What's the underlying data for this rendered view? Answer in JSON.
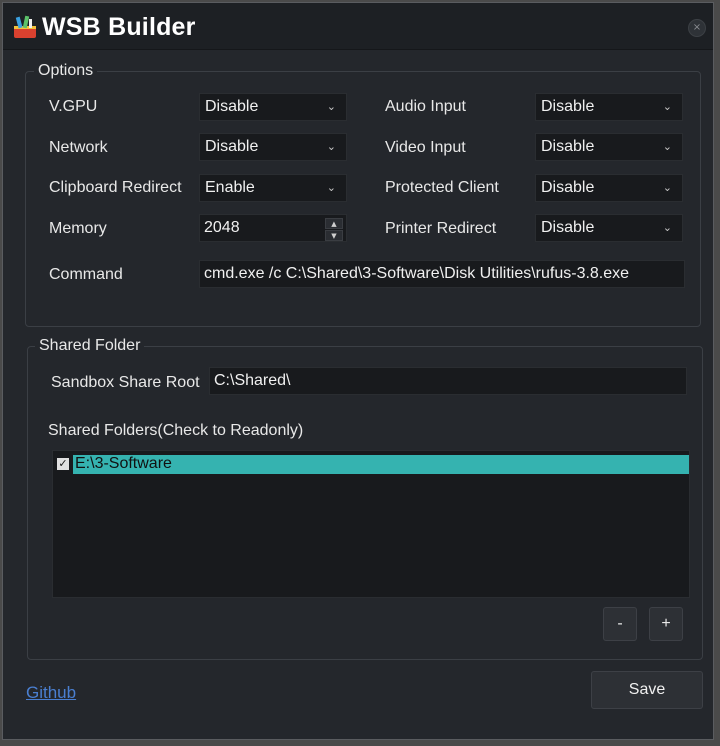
{
  "window": {
    "title": "WSB Builder",
    "close_icon": "×"
  },
  "options": {
    "title": "Options",
    "vgpu": {
      "label": "V.GPU",
      "value": "Disable"
    },
    "network": {
      "label": "Network",
      "value": "Disable"
    },
    "clipboard": {
      "label": "Clipboard Redirect",
      "value": "Enable"
    },
    "memory": {
      "label": "Memory",
      "value": "2048"
    },
    "audio": {
      "label": "Audio Input",
      "value": "Disable"
    },
    "video": {
      "label": "Video Input",
      "value": "Disable"
    },
    "protected": {
      "label": "Protected Client",
      "value": "Disable"
    },
    "printer": {
      "label": "Printer Redirect",
      "value": "Disable"
    },
    "command": {
      "label": "Command",
      "value": "cmd.exe /c C:\\Shared\\3-Software\\Disk Utilities\\rufus-3.8.exe"
    }
  },
  "shared": {
    "title": "Shared Folder",
    "root_label": "Sandbox Share Root",
    "root_value": "C:\\Shared\\",
    "list_label": "Shared Folders(Check to Readonly)",
    "items": [
      {
        "path": "E:\\3-Software",
        "checked": true
      }
    ],
    "remove_label": "-",
    "add_label": "+"
  },
  "footer": {
    "link": "Github",
    "save": "Save"
  },
  "colors": {
    "accent": "#35b3b0",
    "link": "#4a7fd1",
    "background": "#24272c"
  }
}
